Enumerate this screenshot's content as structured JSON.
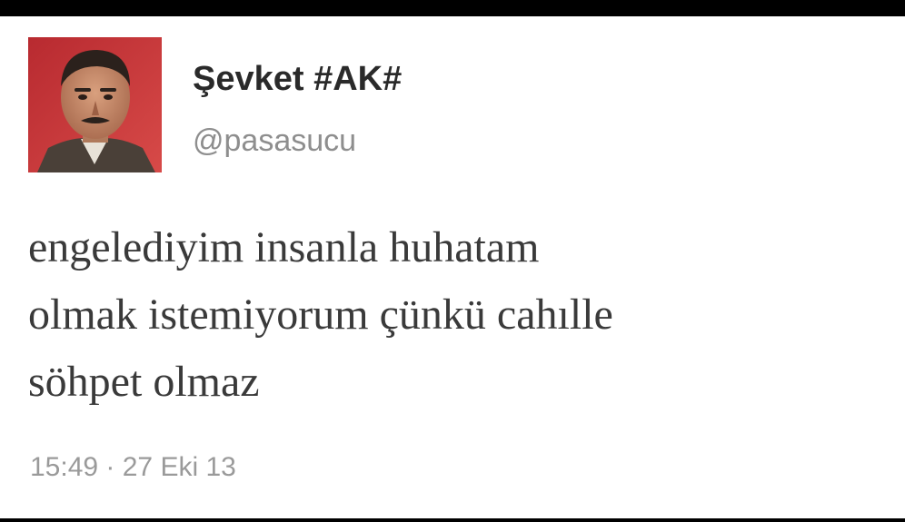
{
  "tweet": {
    "display_name": "Şevket #AK#",
    "handle": "@pasasucu",
    "text_lines": [
      "engelediyim insanla huhatam",
      "olmak istemiyorum çünkü cahılle",
      "söhpet olmaz"
    ],
    "timestamp": "15:49 · 27 Eki 13"
  },
  "colors": {
    "frame": "#000000",
    "card_background": "#ffffff",
    "name_text": "#2a2a2a",
    "handle_text": "#8e8e8e",
    "body_text": "#3a3a3a",
    "timestamp_text": "#9a9a9a",
    "avatar_background": "#c8343a"
  }
}
